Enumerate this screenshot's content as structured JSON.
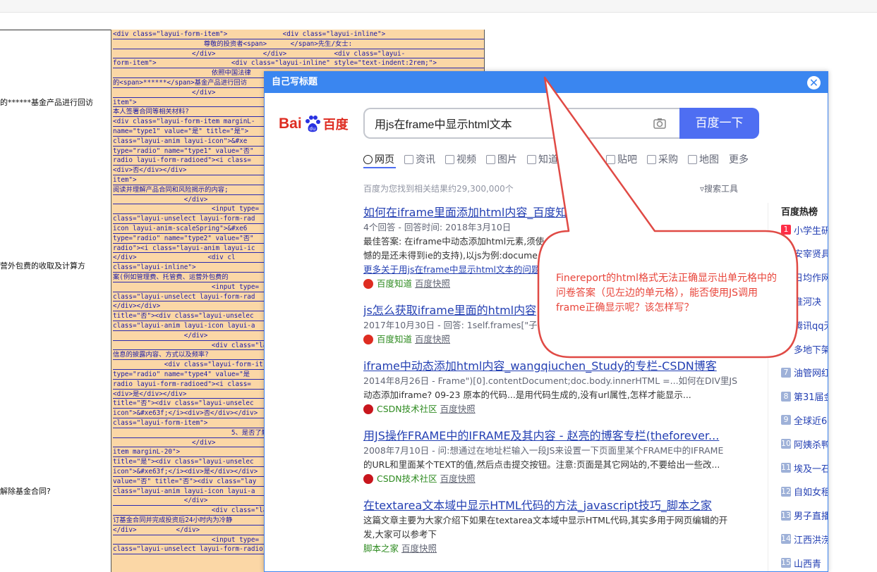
{
  "left_panel": {
    "fragments": [
      "的******基金产品进行回访",
      "营外包费的收取及计算方",
      "解除基金合同?"
    ]
  },
  "code_cell": {
    "lines": [
      "<div class=\"layui-form-item\">              <div class=\"layui-inline\">",
      "                       尊敬的投资者<span>      </span>先生/女士:",
      "                    </div>            </div>            <div class=\"layui-",
      "form-item\">                   <div class=\"layui-inline\" style=\"text-indent:2rem;\">",
      "                         依照中国法律",
      "的<span>******</span>基金产品进行回访",
      "                    </div>",
      "item\">                                   <div cl",
      "本人签署合同等相关材料?",
      "<div class=\"layui-form-item marginL-",
      "name=\"type1\" value=\"是\" title=\"是\">",
      "class=\"layui-anim layui-icon\">&#xe",
      "type=\"radio\" name=\"type1\" value=\"否\"",
      "radio layui-form-radioed\"><i class=",
      "<div>否</div></div>",
      "item\">                                   <div cl",
      "阅读并理解产品合同和风险揭示的内容;",
      "                  </div>",
      "                         <input type=",
      "class=\"layui-unselect layui-form-rad",
      "icon layui-anim-scaleSpring\">&#xe6",
      "type=\"radio\" name=\"type2\" value=\"否\"",
      "radio\"><i class=\"layui-anim layui-ic",
      "</div>                  <div cl",
      "class=\"layui-inline\">",
      "案(例如管理费、托管费、运营外包费的",
      "                         <input type=",
      "class=\"layui-unselect layui-form-rad",
      "</div></div>",
      "title=\"否\"><div class=\"layui-unselec",
      "class=\"layui-anim layui-icon layui-a",
      "                  </div>",
      "                         <div class=\"lay",
      "信息的披露内容、方式以及频率?",
      "             <div class=\"layui-form-it",
      "type=\"radio\" name=\"type4\" value=\"是",
      "radio layui-form-radioed\"><i class=",
      "<div>是</div></div>",
      "title=\"否\"><div class=\"layui-unselec",
      "icon\">&#xe63f;</i><div>否</div></div>",
      "class=\"layui-form-item\">",
      "                              5、是否了解",
      "                    </div>",
      "item marginL-20\">",
      "title=\"是\"><div class=\"layui-unselec",
      "icon\">&#xe63f;</i><div>是</div></div>",
      "value=\"否\" title=\"否\"><div class=\"lay",
      "class=\"layui-anim layui-icon layui-a",
      "                  </div>",
      "                         <div class=\"lay",
      "订基金合同并完成投资后24小时内为冷静",
      "</div>          </div>",
      "                         <input type=",
      "class=\"layui-unselect layui-form-radio layui-form-radioed\"><i class=\"layui-anim layui-"
    ]
  },
  "popup": {
    "title": "自己写标题",
    "close_label": "✕",
    "logo": {
      "left": "Bai",
      "right": "百度"
    },
    "search": {
      "query": "用js在frame中显示html文本",
      "button": "百度一下"
    },
    "tabs": [
      "网页",
      "资讯",
      "视频",
      "图片",
      "知道",
      "",
      "贴吧",
      "采购",
      "地图",
      "更多"
    ],
    "result_count": "百度为您找到相关结果约29,300,000个",
    "search_tools": "搜索工具",
    "results": [
      {
        "title": "如何在iframe里面添加html内容_百度知道",
        "meta": "4个回答 - 回答时间: 2018年3月10日",
        "abstract": "最佳答案: 在iframe中动态添加html元素,须使",
        "abstract2": "憾的是还未得到ie的支持),以js为例:docume",
        "more": "更多关于用js在frame中显示html文本的问题",
        "source": "百度知道",
        "kuaizhao": "百度快照"
      },
      {
        "title": "js怎么获取iframe里面的html内容",
        "meta": "2017年10月30日 - 回答: 1self.frames[\"子",
        "source": "百度知道",
        "kuaizhao": "百度快照"
      },
      {
        "title": "iframe中动态添加html内容_wangqiuchen_Study的专栏-CSDN博客",
        "meta": "2014年8月26日 - Frame\")[0].contentDocument;doc.body.innerHTML =...如何在DIV里JS",
        "abstract": "动态添加iframe? 09-23 原本的代码...是用代码生成的,没有url属性,怎样才能显示...",
        "source": "CSDN技术社区",
        "kuaizhao": "百度快照"
      },
      {
        "title": "用JS操作FRAME中的IFRAME及其内容 - 赵亮的博客专栏(theforever...",
        "meta": "2008年7月10日 - 问:想通过在地址栏输入一段JS来设置一下页面里某个FRAME中的IFRAME",
        "abstract": "的URL和里面某个TEXT的值,然后点击提交按钮。注意:页面是其它网站的,不要给出一些改...",
        "source": "CSDN技术社区",
        "kuaizhao": "百度快照"
      },
      {
        "title": "在textarea文本域中显示HTML代码的方法_javascript技巧_脚本之家",
        "abstract": "这篇文章主要为大家介绍下如果在textarea文本域中显示HTML代码,其实多用于网页编辑的开",
        "abstract2": "发,大家可以参考下",
        "source": "脚本之家",
        "kuaizhao": "百度快照"
      }
    ],
    "hot": {
      "title": "百度热榜",
      "items": [
        {
          "num": "1",
          "label": "小学生研"
        },
        {
          "num": "",
          "label": "安宰贤具"
        },
        {
          "num": "",
          "label": "日均作网"
        },
        {
          "num": "",
          "label": "淮河决"
        },
        {
          "num": "",
          "label": "腾讯qq无"
        },
        {
          "num": "",
          "label": "多地下架"
        },
        {
          "num": "7",
          "label": "油管网红"
        },
        {
          "num": "8",
          "label": "第31届金"
        },
        {
          "num": "9",
          "label": "全球近6"
        },
        {
          "num": "10",
          "label": "阿姨杀鸭"
        },
        {
          "num": "11",
          "label": "埃及一石"
        },
        {
          "num": "12",
          "label": "自如女租"
        },
        {
          "num": "13",
          "label": "男子直播"
        },
        {
          "num": "14",
          "label": "江西洪涝"
        },
        {
          "num": "15",
          "label": "山西青"
        }
      ]
    }
  },
  "callout": {
    "text": "Finereport的html格式无法正确显示出单元格中的问卷答案（见左边的单元格），能否使用JS调用frame正确显示呢？该怎样写？",
    "color": "#e8443a"
  }
}
